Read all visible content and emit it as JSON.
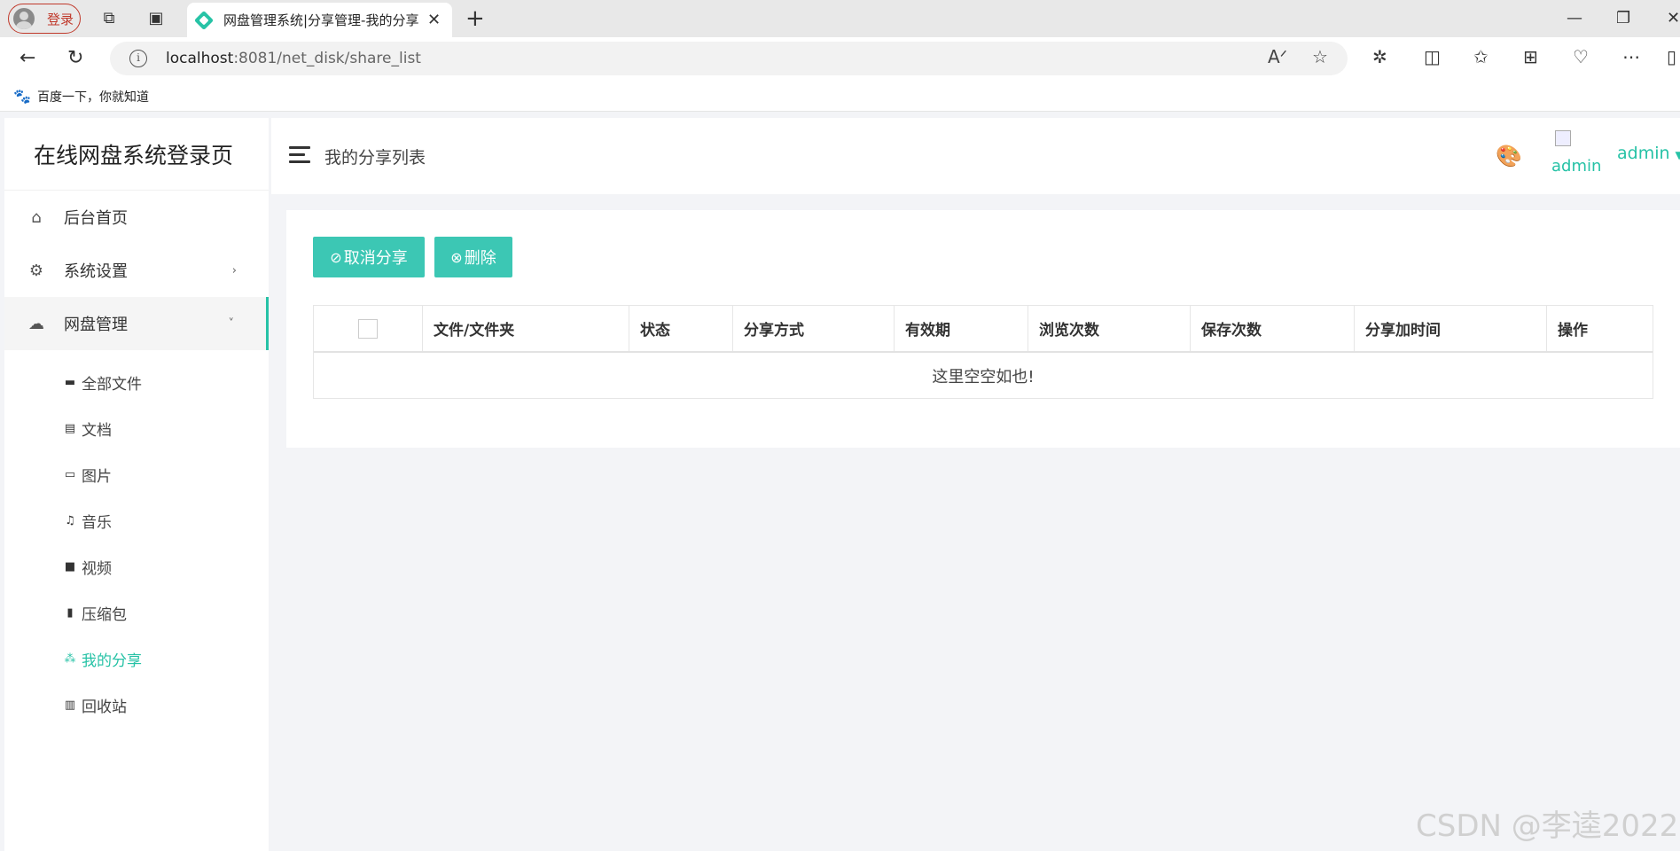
{
  "browser": {
    "profile_label": "登录",
    "tab_title": "网盘管理系统|分享管理-我的分享",
    "url_host": "localhost",
    "url_path": ":8081/net_disk/share_list",
    "bookmark_label": "百度一下，你就知道"
  },
  "sidebar": {
    "brand": "在线网盘系统登录页",
    "items": [
      {
        "label": "后台首页",
        "icon": "home-icon"
      },
      {
        "label": "系统设置",
        "icon": "gear-icon"
      },
      {
        "label": "网盘管理",
        "icon": "cloud-icon"
      }
    ],
    "subitems": [
      {
        "label": "全部文件",
        "icon": "hdd-icon"
      },
      {
        "label": "文档",
        "icon": "file-icon"
      },
      {
        "label": "图片",
        "icon": "image-icon"
      },
      {
        "label": "音乐",
        "icon": "music-icon"
      },
      {
        "label": "视频",
        "icon": "video-icon"
      },
      {
        "label": "压缩包",
        "icon": "archive-icon"
      },
      {
        "label": "我的分享",
        "icon": "share-icon"
      },
      {
        "label": "回收站",
        "icon": "recycle-icon"
      }
    ]
  },
  "header": {
    "breadcrumb": "我的分享列表",
    "avatar_alt": "admin",
    "username": "admin"
  },
  "toolbar": {
    "cancel_share": "取消分享",
    "delete": "删除"
  },
  "table": {
    "columns": [
      "文件/文件夹",
      "状态",
      "分享方式",
      "有效期",
      "浏览次数",
      "保存次数",
      "分享加时间",
      "操作"
    ],
    "empty_text": "这里空空如也!"
  },
  "watermark": "CSDN @李逵2022",
  "colors": {
    "accent": "#26c2a6",
    "button": "#3cc7b4"
  }
}
